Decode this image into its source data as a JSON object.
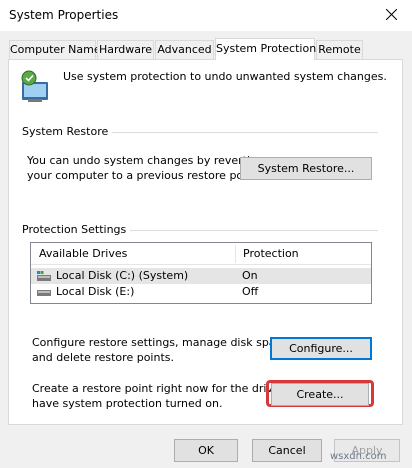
{
  "window": {
    "title": "System Properties"
  },
  "tabs": [
    {
      "label": "Computer Name"
    },
    {
      "label": "Hardware"
    },
    {
      "label": "Advanced"
    },
    {
      "label": "System Protection",
      "active": true
    },
    {
      "label": "Remote"
    }
  ],
  "intro": {
    "text": "Use system protection to undo unwanted system changes."
  },
  "system_restore": {
    "title": "System Restore",
    "description_line1": "You can undo system changes by reverting",
    "description_line2": "your computer to a previous restore point.",
    "button": "System Restore..."
  },
  "protection": {
    "title": "Protection Settings",
    "columns": [
      "Available Drives",
      "Protection"
    ],
    "drives": [
      {
        "name": "Local Disk (C:) (System)",
        "protection": "On"
      },
      {
        "name": "Local Disk (E:)",
        "protection": "Off"
      }
    ]
  },
  "configure": {
    "description_line1": "Configure restore settings, manage disk space,",
    "description_line2": "and delete restore points.",
    "button": "Configure..."
  },
  "create": {
    "description_line1": "Create a restore point right now for the drives that",
    "description_line2": "have system protection turned on.",
    "button": "Create..."
  },
  "footer": {
    "ok": "OK",
    "cancel": "Cancel",
    "apply": "Apply"
  },
  "colors": {
    "highlight": "#d6393a",
    "focus_border": "#0078d7"
  },
  "watermark": "wsxdn.com"
}
